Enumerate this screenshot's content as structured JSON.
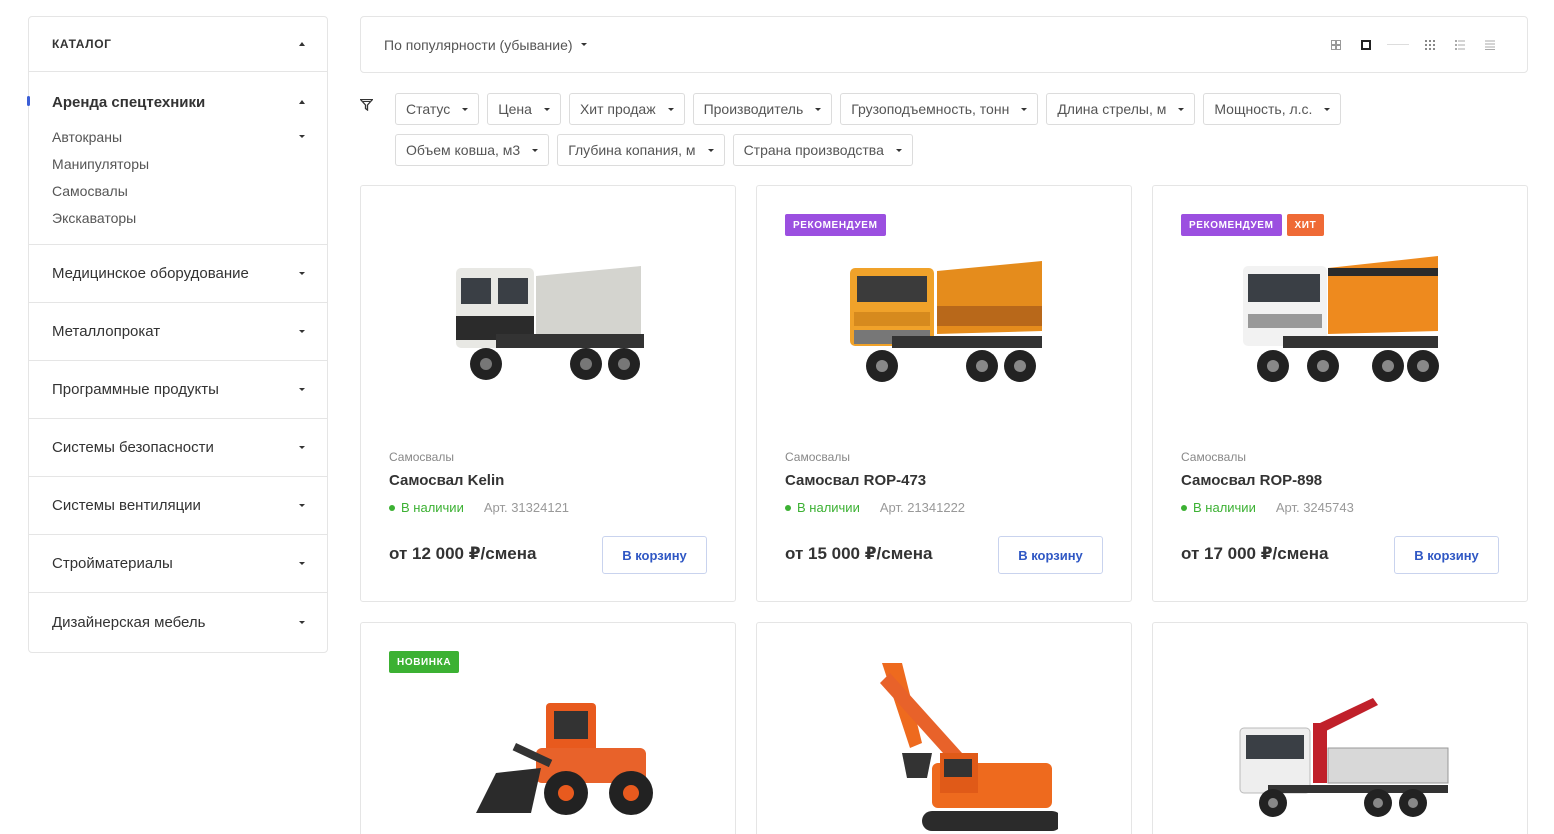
{
  "sidebar": {
    "title": "КАТАЛОГ",
    "active": {
      "label": "Аренда спецтехники",
      "sub": [
        {
          "label": "Автокраны",
          "has_children": true
        },
        {
          "label": "Манипуляторы",
          "has_children": false
        },
        {
          "label": "Самосвалы",
          "has_children": false
        },
        {
          "label": "Экскаваторы",
          "has_children": false
        }
      ]
    },
    "items": [
      "Медицинское оборудование",
      "Металлопрокат",
      "Программные продукты",
      "Системы безопасности",
      "Системы вентиляции",
      "Стройматериалы",
      "Дизайнерская мебель"
    ]
  },
  "sort": {
    "label": "По популярности (убывание)"
  },
  "filters": [
    "Статус",
    "Цена",
    "Хит продаж",
    "Производитель",
    "Грузоподъемность, тонн",
    "Длина стрелы, м",
    "Мощность, л.с.",
    "Объем ковша, м3",
    "Глубина копания, м",
    "Страна производства"
  ],
  "products": [
    {
      "category": "Самосвалы",
      "name": "Самосвал Kelin",
      "stock": "В наличии",
      "article": "Арт. 31324121",
      "price": "от 12 000 ₽/смена",
      "cart": "В корзину",
      "badges": [],
      "image": "dump-truck-white"
    },
    {
      "category": "Самосвалы",
      "name": "Самосвал ROP-473",
      "stock": "В наличии",
      "article": "Арт. 21341222",
      "price": "от 15 000 ₽/смена",
      "cart": "В корзину",
      "badges": [
        "РЕКОМЕНДУЕМ"
      ],
      "image": "dump-truck-orange"
    },
    {
      "category": "Самосвалы",
      "name": "Самосвал ROP-898",
      "stock": "В наличии",
      "article": "Арт. 3245743",
      "price": "от 17 000 ₽/смена",
      "cart": "В корзину",
      "badges": [
        "РЕКОМЕНДУЕМ",
        "ХИТ"
      ],
      "image": "dump-truck-white-orange"
    },
    {
      "badges": [
        "НОВИНКА"
      ],
      "image": "wheel-loader"
    },
    {
      "badges": [],
      "image": "excavator"
    },
    {
      "badges": [],
      "image": "crane-truck"
    }
  ],
  "colors": {
    "accent": "#2f57c4",
    "recommend": "#9b4fe0",
    "hit": "#ef6a36",
    "new": "#3cb133",
    "in_stock": "#3cb133"
  }
}
